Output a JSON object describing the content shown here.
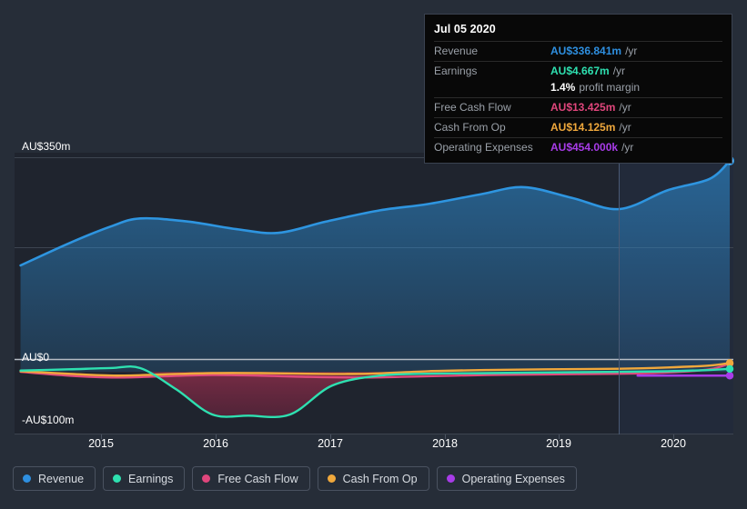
{
  "chart_data": {
    "type": "area",
    "title": "",
    "xlabel": "",
    "ylabel": "",
    "currency": "AU$",
    "grid": true,
    "legend_position": "bottom",
    "xlim": [
      2014.55,
      2020.55
    ],
    "ylim": [
      -100,
      350
    ],
    "x_ticks": [
      "2015",
      "2016",
      "2017",
      "2018",
      "2019",
      "2020"
    ],
    "y_ticks": [
      "AU$350m",
      "AU$0",
      "-AU$100m"
    ],
    "y_tick_values": [
      350,
      0,
      -100
    ],
    "forecast_divider_x": 2019.6,
    "series": [
      {
        "name": "Revenue",
        "color": "#2e95e0",
        "x": [
          2014.6,
          2015.0,
          2015.35,
          2015.6,
          2016.0,
          2016.4,
          2016.75,
          2017.15,
          2017.6,
          2018.0,
          2018.45,
          2018.8,
          2019.2,
          2019.6,
          2020.0,
          2020.35,
          2020.52
        ],
        "values": [
          170,
          205,
          232,
          245,
          240,
          228,
          222,
          240,
          258,
          268,
          284,
          295,
          278,
          260,
          290,
          308,
          337
        ]
      },
      {
        "name": "Earnings",
        "color": "#2ee0b0",
        "x": [
          2014.6,
          2015.0,
          2015.35,
          2015.6,
          2015.9,
          2016.2,
          2016.5,
          2016.85,
          2017.2,
          2017.6,
          2018.0,
          2018.5,
          2019.0,
          2019.6,
          2020.0,
          2020.35,
          2020.52
        ],
        "values": [
          2,
          4,
          6,
          6,
          -28,
          -68,
          -70,
          -68,
          -22,
          -6,
          -3,
          -2,
          -1,
          0,
          1,
          3,
          4.667
        ]
      },
      {
        "name": "Free Cash Flow",
        "color": "#e04a7c",
        "x": [
          2014.6,
          2015.0,
          2015.4,
          2015.8,
          2016.2,
          2016.6,
          2017.0,
          2017.5,
          2018.0,
          2018.5,
          2019.0,
          2019.6,
          2020.0,
          2020.35,
          2020.52
        ],
        "values": [
          0,
          -6,
          -9,
          -7,
          -5,
          -6,
          -8,
          -9,
          -7,
          -5,
          -4,
          -3,
          -1,
          4,
          13.425
        ]
      },
      {
        "name": "Cash From Op",
        "color": "#f0a83c",
        "x": [
          2014.6,
          2015.0,
          2015.4,
          2015.8,
          2016.2,
          2016.6,
          2017.0,
          2017.5,
          2018.0,
          2018.5,
          2019.0,
          2019.6,
          2020.0,
          2020.35,
          2020.52
        ],
        "values": [
          1,
          -3,
          -6,
          -4,
          -2,
          -2,
          -3,
          -3,
          1,
          3,
          4,
          5,
          7,
          10,
          14.125
        ]
      },
      {
        "name": "Operating Expenses",
        "color": "#a83ce8",
        "x": [
          2019.75,
          2020.0,
          2020.25,
          2020.52
        ],
        "values": [
          -6,
          -6,
          -6,
          -6
        ]
      }
    ]
  },
  "tooltip": {
    "title": "Jul 05 2020",
    "rows": [
      {
        "label": "Revenue",
        "value": "AU$336.841m",
        "unit": "/yr",
        "color": "#2e8fe0"
      },
      {
        "label": "Earnings",
        "value": "AU$4.667m",
        "unit": "/yr",
        "color": "#2ee0b0"
      },
      {
        "label": "",
        "value": "1.4%",
        "unit": "profit margin",
        "color": "#ffffff"
      },
      {
        "label": "Free Cash Flow",
        "value": "AU$13.425m",
        "unit": "/yr",
        "color": "#e0467c"
      },
      {
        "label": "Cash From Op",
        "value": "AU$14.125m",
        "unit": "/yr",
        "color": "#f0a83c"
      },
      {
        "label": "Operating Expenses",
        "value": "AU$454.000k",
        "unit": "/yr",
        "color": "#a83ce8"
      }
    ]
  },
  "legend": {
    "items": [
      {
        "label": "Revenue",
        "color": "#2e8fe0"
      },
      {
        "label": "Earnings",
        "color": "#2ee0b0"
      },
      {
        "label": "Free Cash Flow",
        "color": "#e0467c"
      },
      {
        "label": "Cash From Op",
        "color": "#f0a83c"
      },
      {
        "label": "Operating Expenses",
        "color": "#a83ce8"
      }
    ]
  },
  "colors": {
    "background": "#262d38",
    "plot_background": "#1f242e",
    "gridline": "#3d4450",
    "zero_line": "#b6bcc4",
    "tooltip_background": "#080808",
    "forecast_divider": "#4a5a74"
  }
}
